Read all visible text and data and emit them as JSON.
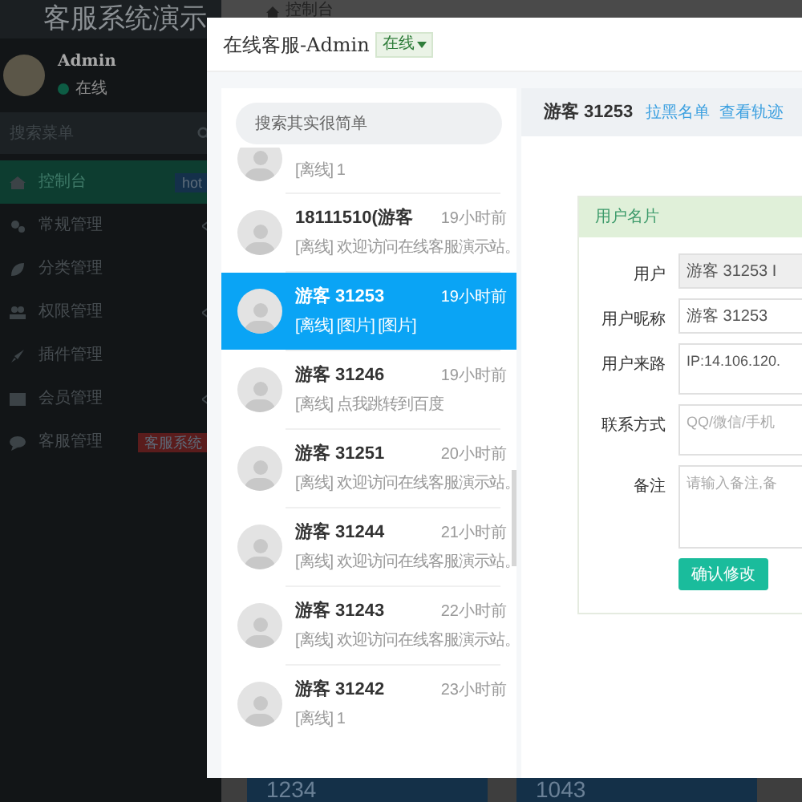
{
  "sidebar": {
    "title": "客服系统演示",
    "user": {
      "name": "Admin",
      "status": "在线"
    },
    "search": {
      "placeholder": "搜索菜单"
    },
    "items": [
      {
        "label": "控制台",
        "selected": true,
        "expandable": false,
        "badge": {
          "text": "hot",
          "color": "#14304a"
        }
      },
      {
        "label": "常规管理",
        "selected": false,
        "expandable": true
      },
      {
        "label": "分类管理",
        "selected": false,
        "expandable": false
      },
      {
        "label": "权限管理",
        "selected": false,
        "expandable": true
      },
      {
        "label": "插件管理",
        "selected": false,
        "expandable": false
      },
      {
        "label": "会员管理",
        "selected": false,
        "expandable": true
      },
      {
        "label": "客服管理",
        "selected": false,
        "expandable": false,
        "badge": {
          "text": "客服系统",
          "color": "#5a1c1c"
        }
      }
    ]
  },
  "top_tab": {
    "label": "控制台"
  },
  "stats": [
    "1234",
    "1043"
  ],
  "dialog": {
    "title": "在线客服-Admin",
    "status": "在线",
    "search": {
      "placeholder": "搜索其实很简单"
    },
    "conversations": [
      {
        "preview": "[离线] 1",
        "selected": false
      },
      {
        "name": "18111510(游客",
        "time": "19小时前",
        "preview": "[离线] 欢迎访问在线客服演示站。",
        "selected": false
      },
      {
        "name": "游客  31253",
        "time": "19小时前",
        "preview": "[离线] [图片] [图片]",
        "selected": true
      },
      {
        "name": "游客  31246",
        "time": "19小时前",
        "preview": "[离线] 点我跳转到百度",
        "selected": false
      },
      {
        "name": "游客  31251",
        "time": "20小时前",
        "preview": "[离线] 欢迎访问在线客服演示站。",
        "selected": false
      },
      {
        "name": "游客  31244",
        "time": "21小时前",
        "preview": "[离线] 欢迎访问在线客服演示站。",
        "selected": false
      },
      {
        "name": "游客  31243",
        "time": "22小时前",
        "preview": "[离线] 欢迎访问在线客服演示站。",
        "selected": false
      },
      {
        "name": "游客  31242",
        "time": "23小时前",
        "preview": "[离线] 1",
        "selected": false
      }
    ],
    "detail": {
      "name": "游客  31253",
      "links": [
        "拉黑名单",
        "查看轨迹"
      ],
      "card_title": "用户名片",
      "fields": [
        {
          "label": "用户",
          "kind": "readonly",
          "value": "游客 31253 I"
        },
        {
          "label": "用户昵称",
          "kind": "input",
          "value": "游客 31253"
        },
        {
          "label": "用户来路",
          "kind": "textarea",
          "value": "IP:14.106.120."
        },
        {
          "label": "联系方式",
          "kind": "textarea",
          "placeholder": "QQ/微信/手机"
        },
        {
          "label": "备注",
          "kind": "bigtextarea",
          "placeholder": "请输入备注,备"
        }
      ],
      "submit": "确认修改"
    }
  }
}
